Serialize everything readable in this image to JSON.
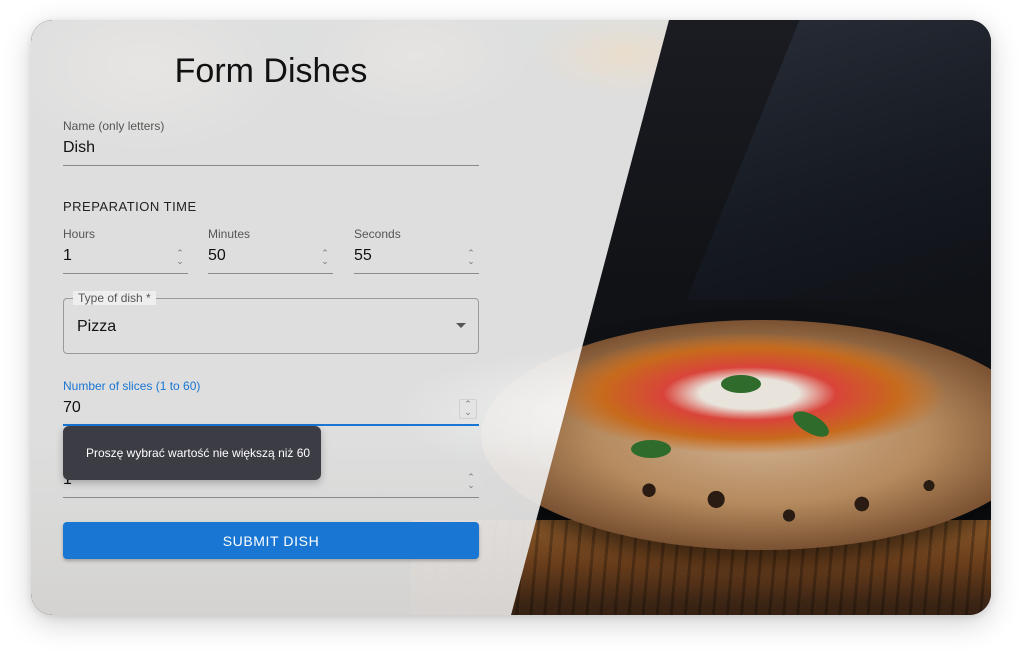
{
  "form": {
    "title": "Form Dishes",
    "name": {
      "label": "Name (only letters)",
      "value": "Dish"
    },
    "preparation_time": {
      "heading": "PREPARATION TIME",
      "hours": {
        "label": "Hours",
        "value": "1"
      },
      "minutes": {
        "label": "Minutes",
        "value": "50"
      },
      "seconds": {
        "label": "Seconds",
        "value": "55"
      }
    },
    "type_of_dish": {
      "label": "Type of dish *",
      "value": "Pizza"
    },
    "slices": {
      "label": "Number of slices (1 to 60)",
      "value": "70"
    },
    "validation_tooltip": "Proszę wybrać wartość nie większą niż 60",
    "diameter": {
      "value": "1"
    },
    "submit_label": "SUBMIT DISH"
  },
  "colors": {
    "accent": "#1976d2",
    "tooltip_bg": "#3c3c45"
  },
  "icons": {
    "spinner": "up-down-chevron-icon",
    "dropdown": "caret-down-icon"
  }
}
